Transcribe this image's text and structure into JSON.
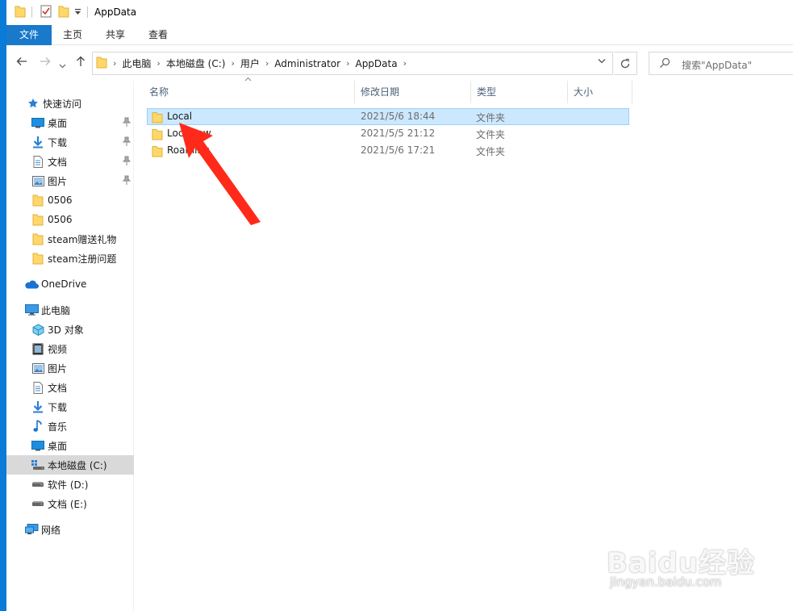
{
  "window": {
    "title": "AppData"
  },
  "ribbon": {
    "tabs": [
      {
        "label": "文件"
      },
      {
        "label": "主页"
      },
      {
        "label": "共享"
      },
      {
        "label": "查看"
      }
    ]
  },
  "address": {
    "breadcrumbs": [
      {
        "label": "此电脑"
      },
      {
        "label": "本地磁盘 (C:)"
      },
      {
        "label": "用户"
      },
      {
        "label": "Administrator"
      },
      {
        "label": "AppData"
      }
    ],
    "separator": "›"
  },
  "search": {
    "placeholder": "搜索\"AppData\""
  },
  "navigation": {
    "quick_access": {
      "label": "快速访问"
    },
    "quick_items": [
      {
        "label": "桌面",
        "icon": "desktop-icon",
        "pinned": true
      },
      {
        "label": "下载",
        "icon": "download-icon",
        "pinned": true
      },
      {
        "label": "文档",
        "icon": "document-icon",
        "pinned": true
      },
      {
        "label": "图片",
        "icon": "picture-icon",
        "pinned": true
      },
      {
        "label": "0506",
        "icon": "folder-icon",
        "pinned": false
      },
      {
        "label": "0506",
        "icon": "folder-icon",
        "pinned": false
      },
      {
        "label": "steam赠送礼物",
        "icon": "folder-icon",
        "pinned": false
      },
      {
        "label": "steam注册问题",
        "icon": "folder-icon",
        "pinned": false
      }
    ],
    "onedrive": {
      "label": "OneDrive"
    },
    "this_pc": {
      "label": "此电脑"
    },
    "pc_items": [
      {
        "label": "3D 对象",
        "icon": "3d-objects-icon"
      },
      {
        "label": "视频",
        "icon": "video-icon"
      },
      {
        "label": "图片",
        "icon": "picture-icon"
      },
      {
        "label": "文档",
        "icon": "document-icon"
      },
      {
        "label": "下载",
        "icon": "download-icon"
      },
      {
        "label": "音乐",
        "icon": "music-icon"
      },
      {
        "label": "桌面",
        "icon": "desktop-icon"
      },
      {
        "label": "本地磁盘 (C:)",
        "icon": "system-drive-icon",
        "selected": true
      },
      {
        "label": "软件 (D:)",
        "icon": "drive-icon"
      },
      {
        "label": "文档 (E:)",
        "icon": "drive-icon"
      }
    ],
    "network": {
      "label": "网络"
    }
  },
  "columns": [
    {
      "label": "名称"
    },
    {
      "label": "修改日期"
    },
    {
      "label": "类型"
    },
    {
      "label": "大小"
    }
  ],
  "files": [
    {
      "name": "Local",
      "modified": "2021/5/6 18:44",
      "type": "文件夹",
      "selected": true
    },
    {
      "name": "LocalLow",
      "modified": "2021/5/5 21:12",
      "type": "文件夹",
      "selected": false
    },
    {
      "name": "Roaming",
      "modified": "2021/5/6 17:21",
      "type": "文件夹",
      "selected": false
    }
  ],
  "watermark": {
    "brand": "Baidu经验",
    "url": "jingyan.baidu.com"
  },
  "colors": {
    "accent": "#1979ca",
    "selection": "#cce8ff",
    "folder": "#ffd76a",
    "arrow": "#ff2a1a"
  }
}
